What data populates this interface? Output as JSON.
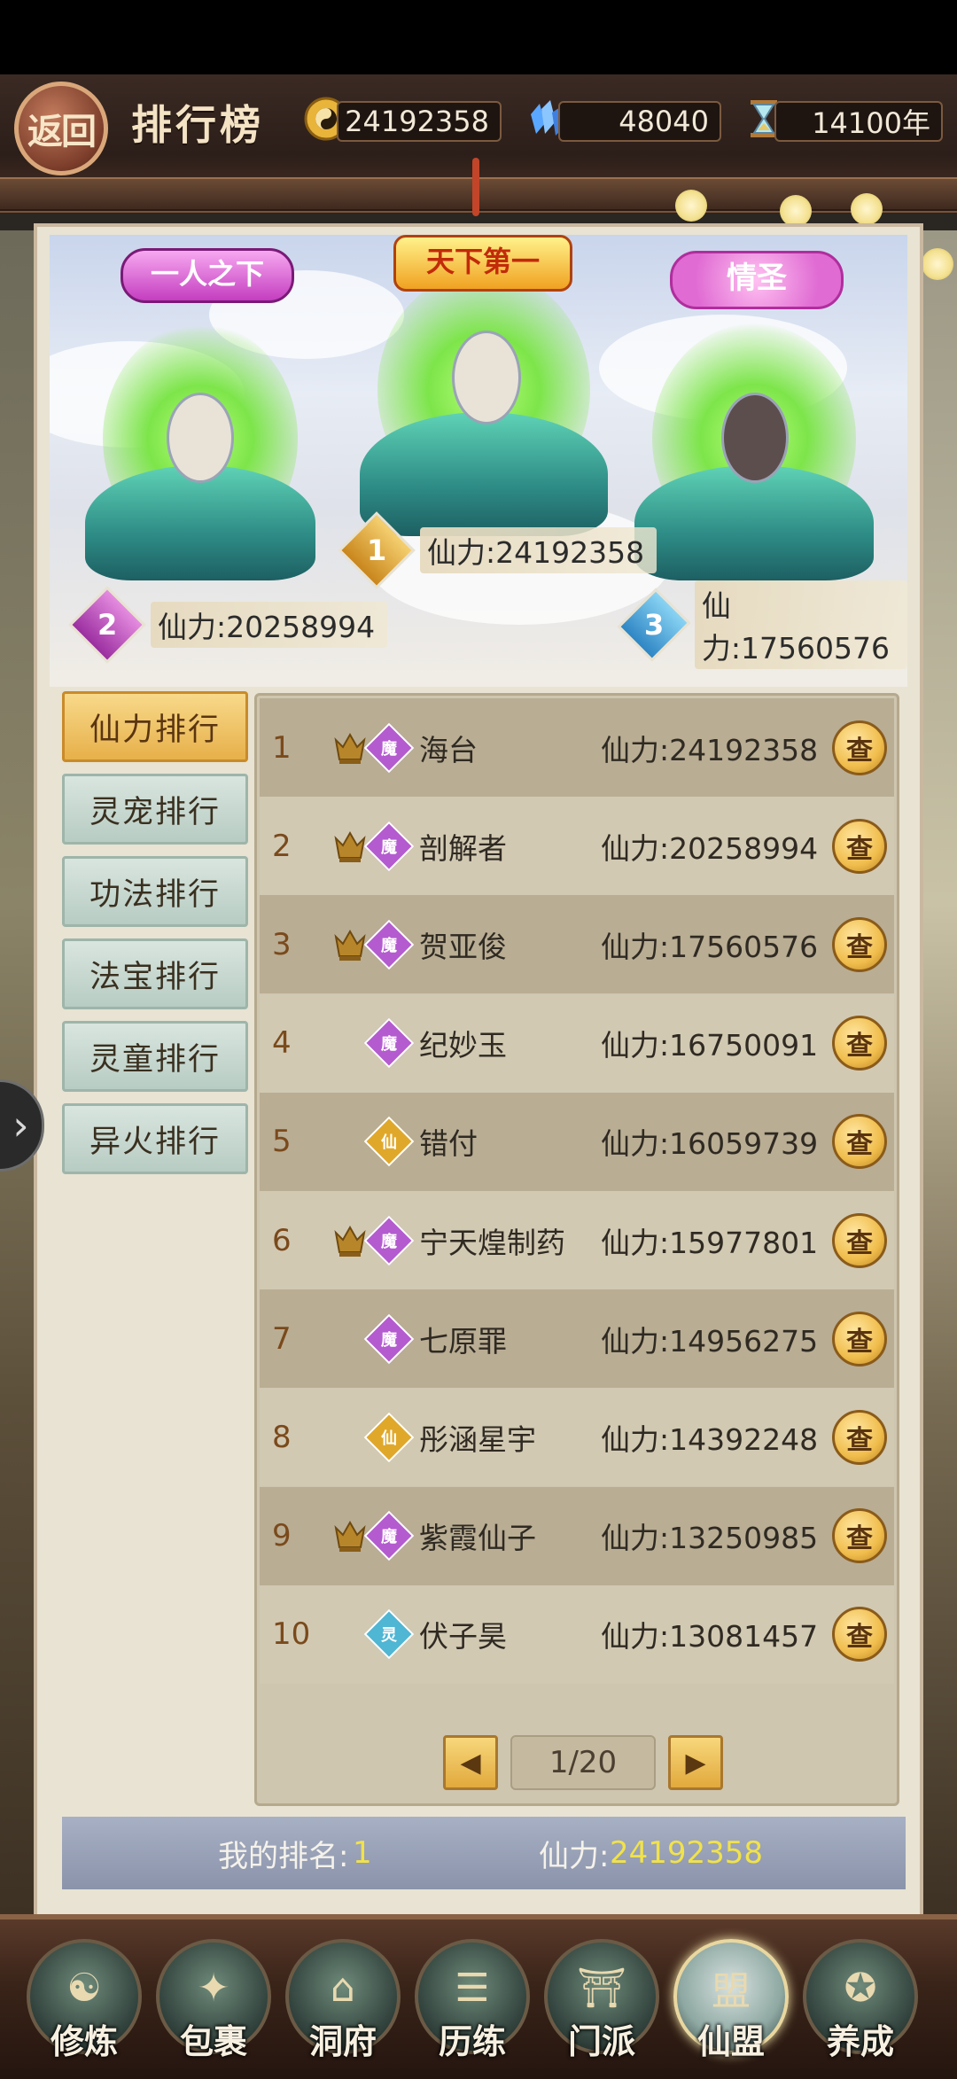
{
  "header": {
    "back_label": "返回",
    "title": "排行榜",
    "currencies": [
      {
        "icon": "yin-yang-coin-icon",
        "value": "24192358"
      },
      {
        "icon": "crystal-gem-icon",
        "value": "48040"
      },
      {
        "icon": "hourglass-icon",
        "value": "14100年"
      }
    ]
  },
  "podium": {
    "first": {
      "badge": "天下第一",
      "rank": "1",
      "power": "仙力:24192358"
    },
    "second": {
      "badge": "一人之下",
      "rank": "2",
      "power": "仙力:20258994"
    },
    "third": {
      "badge": "情圣",
      "rank": "3",
      "power": "仙力:17560576"
    }
  },
  "tabs": [
    "仙力排行",
    "灵宠排行",
    "功法排行",
    "法宝排行",
    "灵童排行",
    "异火排行"
  ],
  "active_tab": 0,
  "rows": [
    {
      "rank": "1",
      "crown": true,
      "cls": "魔",
      "clsColor": "#b45bd0",
      "name": "海台",
      "power": "仙力:24192358"
    },
    {
      "rank": "2",
      "crown": true,
      "cls": "魔",
      "clsColor": "#b45bd0",
      "name": "剖解者",
      "power": "仙力:20258994"
    },
    {
      "rank": "3",
      "crown": true,
      "cls": "魔",
      "clsColor": "#b45bd0",
      "name": "贺亚俊",
      "power": "仙力:17560576"
    },
    {
      "rank": "4",
      "crown": false,
      "cls": "魔",
      "clsColor": "#b45bd0",
      "name": "纪妙玉",
      "power": "仙力:16750091"
    },
    {
      "rank": "5",
      "crown": false,
      "cls": "仙",
      "clsColor": "#e0a82a",
      "name": "错付",
      "power": "仙力:16059739"
    },
    {
      "rank": "6",
      "crown": true,
      "cls": "魔",
      "clsColor": "#b45bd0",
      "name": "宁天煌制药",
      "power": "仙力:15977801"
    },
    {
      "rank": "7",
      "crown": false,
      "cls": "魔",
      "clsColor": "#b45bd0",
      "name": "七原罪",
      "power": "仙力:14956275"
    },
    {
      "rank": "8",
      "crown": false,
      "cls": "仙",
      "clsColor": "#e0a82a",
      "name": "彤涵星宇",
      "power": "仙力:14392248"
    },
    {
      "rank": "9",
      "crown": true,
      "cls": "魔",
      "clsColor": "#b45bd0",
      "name": "紫霞仙子",
      "power": "仙力:13250985"
    },
    {
      "rank": "10",
      "crown": false,
      "cls": "灵",
      "clsColor": "#4fb6d4",
      "name": "伏子昊",
      "power": "仙力:13081457"
    }
  ],
  "view_label": "查",
  "pager": {
    "prev_icon": "left-arrow-icon",
    "page": "1/20",
    "next_icon": "right-arrow-icon"
  },
  "my_rank": {
    "label": "我的排名:",
    "value": "1",
    "power_label": "仙力:",
    "power_value": "24192358"
  },
  "nav": [
    {
      "label": "修炼",
      "glyph": "☯"
    },
    {
      "label": "包裹",
      "glyph": "✦"
    },
    {
      "label": "洞府",
      "glyph": "⌂"
    },
    {
      "label": "历练",
      "glyph": "☰"
    },
    {
      "label": "门派",
      "glyph": "⛩"
    },
    {
      "label": "仙盟",
      "glyph": "盟"
    },
    {
      "label": "养成",
      "glyph": "✪"
    }
  ],
  "active_nav": 5
}
